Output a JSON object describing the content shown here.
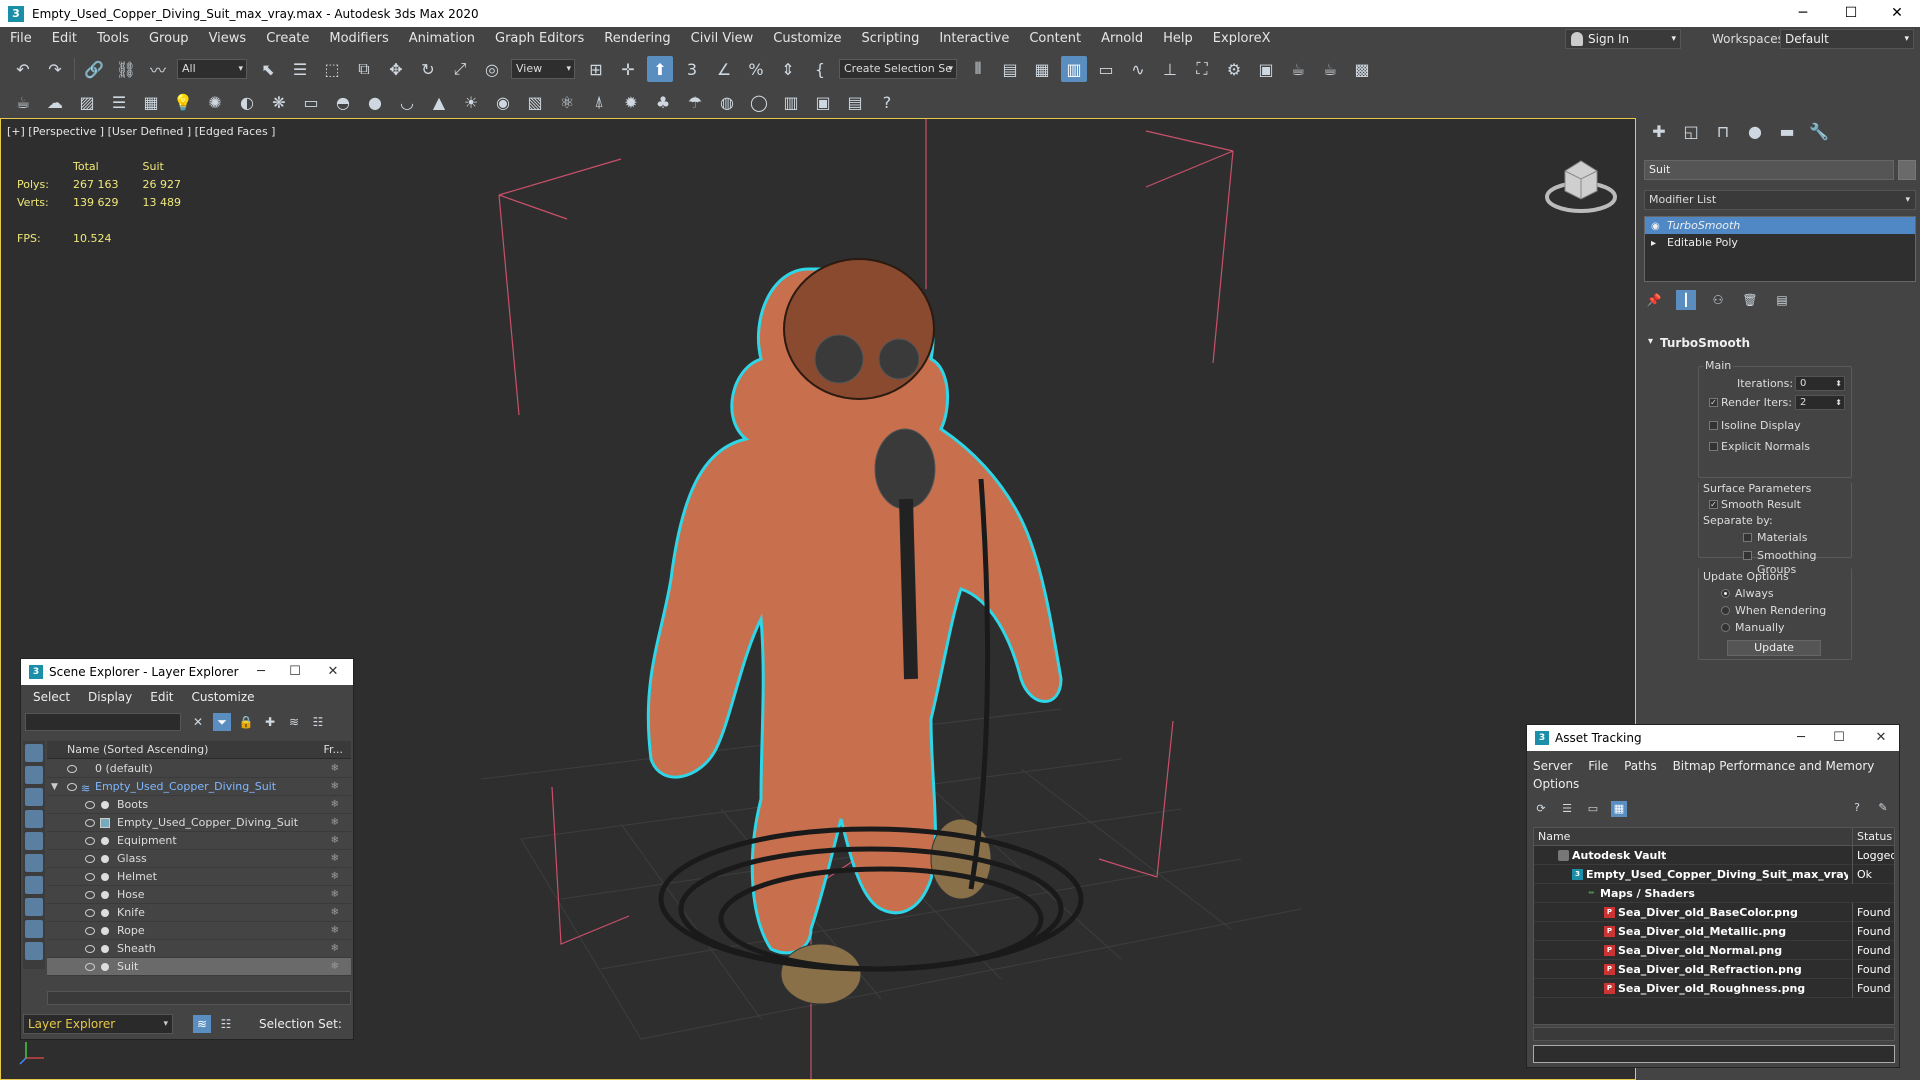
{
  "window": {
    "title": "Empty_Used_Copper_Diving_Suit_max_vray.max - Autodesk 3ds Max 2020",
    "app_icon": "3",
    "minimize": "─",
    "maximize": "☐",
    "close": "✕"
  },
  "menu": [
    "File",
    "Edit",
    "Tools",
    "Group",
    "Views",
    "Create",
    "Modifiers",
    "Animation",
    "Graph Editors",
    "Rendering",
    "Civil View",
    "Customize",
    "Scripting",
    "Interactive",
    "Content",
    "Arnold",
    "Help",
    "ExploreX"
  ],
  "account": {
    "sign_in": "Sign In",
    "workspaces_label": "Workspaces:",
    "workspace_value": "Default"
  },
  "toolbar": {
    "filter_value": "All",
    "ref_coord": "View",
    "selection_set": "Create Selection Se",
    "snap_3": "3",
    "percent": "%"
  },
  "viewport": {
    "label": "[+] [Perspective ] [User Defined ] [Edged Faces ]",
    "stats": {
      "header_total": "Total",
      "header_obj": "Suit",
      "polys_label": "Polys:",
      "polys_total": "267 163",
      "polys_obj": "26 927",
      "verts_label": "Verts:",
      "verts_total": "139 629",
      "verts_obj": "13 489",
      "fps_label": "FPS:",
      "fps_value": "10.524"
    }
  },
  "scene_explorer": {
    "title": "Scene Explorer - Layer Explorer",
    "menu": [
      "Select",
      "Display",
      "Edit",
      "Customize"
    ],
    "col_name": "Name (Sorted Ascending)",
    "col_frozen": "Fr...",
    "rows": [
      {
        "label": "0 (default)",
        "indent": 0
      },
      {
        "label": "Empty_Used_Copper_Diving_Suit",
        "indent": 0
      },
      {
        "label": "Boots",
        "indent": 1
      },
      {
        "label": "Empty_Used_Copper_Diving_Suit",
        "indent": 1
      },
      {
        "label": "Equipment",
        "indent": 1
      },
      {
        "label": "Glass",
        "indent": 1
      },
      {
        "label": "Helmet",
        "indent": 1
      },
      {
        "label": "Hose",
        "indent": 1
      },
      {
        "label": "Knife",
        "indent": 1
      },
      {
        "label": "Rope",
        "indent": 1
      },
      {
        "label": "Sheath",
        "indent": 1
      },
      {
        "label": "Suit",
        "indent": 1
      }
    ],
    "layer_explorer": "Layer Explorer",
    "selection_set": "Selection Set:"
  },
  "command_panel": {
    "object_name": "Suit",
    "modifier_list": "Modifier List",
    "stack": [
      "TurboSmooth",
      "Editable Poly"
    ],
    "rollout_title": "TurboSmooth",
    "main_label": "Main",
    "iterations_label": "Iterations:",
    "iterations_value": "0",
    "render_iters_label": "Render Iters:",
    "render_iters_value": "2",
    "isoline": "Isoline Display",
    "explicit_normals": "Explicit Normals",
    "surface_params": "Surface Parameters",
    "smooth_result": "Smooth Result",
    "separate_by": "Separate by:",
    "materials": "Materials",
    "smoothing_groups": "Smoothing Groups",
    "update_options": "Update Options",
    "always": "Always",
    "when_rendering": "When Rendering",
    "manually": "Manually",
    "update_btn": "Update"
  },
  "asset_tracking": {
    "title": "Asset Tracking",
    "menu": [
      "Server",
      "File",
      "Paths",
      "Bitmap Performance and Memory",
      "Options"
    ],
    "col_name": "Name",
    "col_status": "Status",
    "rows": [
      {
        "name": "Autodesk Vault",
        "status": "Logged",
        "indent": 1
      },
      {
        "name": "Empty_Used_Copper_Diving_Suit_max_vray.max",
        "status": "Ok",
        "indent": 2
      },
      {
        "name": "Maps / Shaders",
        "status": "",
        "indent": 3
      },
      {
        "name": "Sea_Diver_old_BaseColor.png",
        "status": "Found",
        "indent": 4
      },
      {
        "name": "Sea_Diver_old_Metallic.png",
        "status": "Found",
        "indent": 4
      },
      {
        "name": "Sea_Diver_old_Normal.png",
        "status": "Found",
        "indent": 4
      },
      {
        "name": "Sea_Diver_old_Refraction.png",
        "status": "Found",
        "indent": 4
      },
      {
        "name": "Sea_Diver_old_Roughness.png",
        "status": "Found",
        "indent": 4
      }
    ]
  },
  "colors": {
    "accent": "#5b8ec0",
    "viewport_border": "#e6c84a",
    "stats_text": "#f0e87a",
    "selection_outline": "#2fd6e8"
  }
}
